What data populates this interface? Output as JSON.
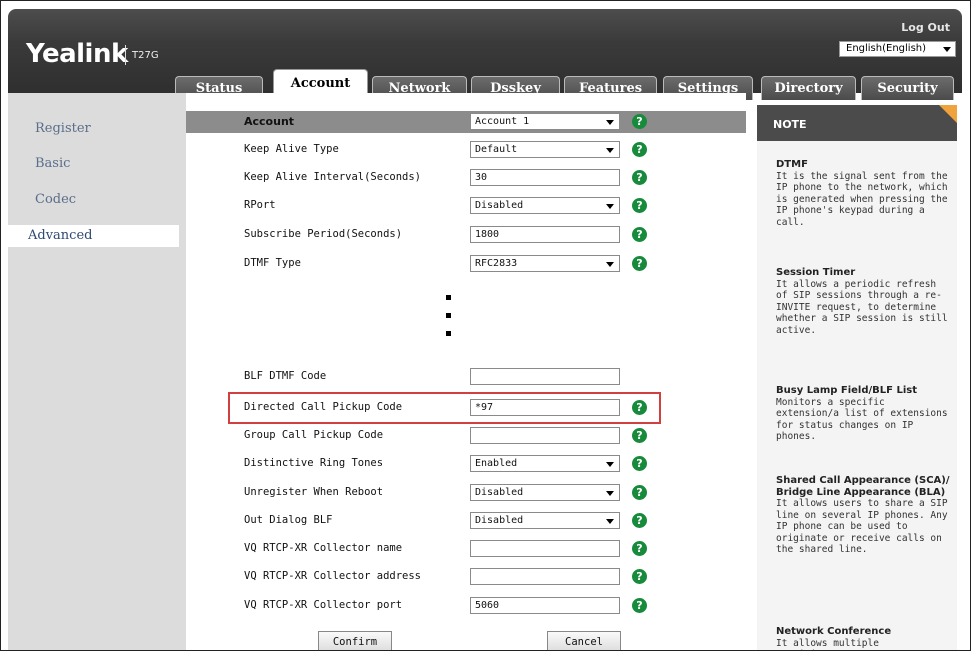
{
  "header": {
    "logo": "Yealink",
    "model": "T27G",
    "logout": "Log Out",
    "language": "English(English)"
  },
  "tabs": [
    {
      "label": "Status"
    },
    {
      "label": "Account"
    },
    {
      "label": "Network"
    },
    {
      "label": "Dsskey"
    },
    {
      "label": "Features"
    },
    {
      "label": "Settings"
    },
    {
      "label": "Directory"
    },
    {
      "label": "Security"
    }
  ],
  "sidebar": {
    "items": [
      {
        "label": "Register"
      },
      {
        "label": "Basic"
      },
      {
        "label": "Codec"
      },
      {
        "label": "Advanced"
      }
    ]
  },
  "form": {
    "account_label": "Account",
    "account_value": "Account 1",
    "rows": [
      {
        "label": "Keep Alive Type",
        "value": "Default"
      },
      {
        "label": "Keep Alive Interval(Seconds)",
        "value": "30"
      },
      {
        "label": "RPort",
        "value": "Disabled"
      },
      {
        "label": "Subscribe Period(Seconds)",
        "value": "1800"
      },
      {
        "label": "DTMF Type",
        "value": "RFC2833"
      },
      {
        "label": "BLF DTMF Code",
        "value": ""
      },
      {
        "label": "Directed Call Pickup Code",
        "value": "*97"
      },
      {
        "label": "Group Call Pickup Code",
        "value": ""
      },
      {
        "label": "Distinctive Ring Tones",
        "value": "Enabled"
      },
      {
        "label": "Unregister When Reboot",
        "value": "Disabled"
      },
      {
        "label": "Out Dialog BLF",
        "value": "Disabled"
      },
      {
        "label": "VQ RTCP-XR Collector name",
        "value": ""
      },
      {
        "label": "VQ RTCP-XR Collector address",
        "value": ""
      },
      {
        "label": "VQ RTCP-XR Collector port",
        "value": "5060"
      }
    ],
    "help_glyph": "?",
    "confirm": "Confirm",
    "cancel": "Cancel"
  },
  "note": {
    "title": "NOTE",
    "blocks": [
      {
        "heading": "DTMF",
        "text": "It is the signal sent from the IP phone to the network, which is generated when pressing the IP phone's keypad during a call."
      },
      {
        "heading": "Session Timer",
        "text": "It allows a periodic refresh of SIP sessions through a re-INVITE request, to determine whether a SIP session is still active."
      },
      {
        "heading": "Busy Lamp Field/BLF List",
        "text": "Monitors a specific extension/a list of extensions for status changes on IP phones."
      },
      {
        "heading": "Shared Call Appearance (SCA)/ Bridge Line Appearance (BLA)",
        "text": "It allows users to share a SIP line on several IP phones. Any IP phone can be used to originate or receive calls on the shared line."
      },
      {
        "heading": "Network Conference",
        "text": "It allows multiple participants"
      }
    ]
  },
  "colors": {
    "header_bg": "#3a3a3a",
    "highlight_border": "#d04040",
    "help_icon": "#178a3c",
    "note_corner": "#f0a23c"
  }
}
